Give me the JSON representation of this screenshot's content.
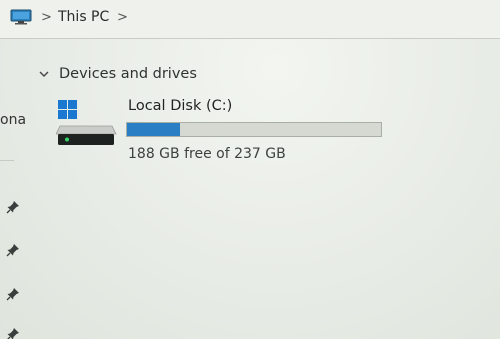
{
  "address_bar": {
    "location_icon": "this-pc-monitor-icon",
    "breadcrumb": [
      "This PC"
    ],
    "separator": ">"
  },
  "nav_pane": {
    "partial_label": "ona",
    "pinned_icons": [
      "pin-icon",
      "pin-icon",
      "pin-icon",
      "pin-icon"
    ]
  },
  "main": {
    "section": {
      "title": "Devices and drives",
      "expanded": true,
      "drives": [
        {
          "icon": "windows-drive-icon",
          "name": "Local Disk (C:)",
          "free_text": "188 GB free of 237 GB",
          "used_fraction": 0.2068,
          "bar_color": "#2a7fc4"
        }
      ]
    }
  }
}
